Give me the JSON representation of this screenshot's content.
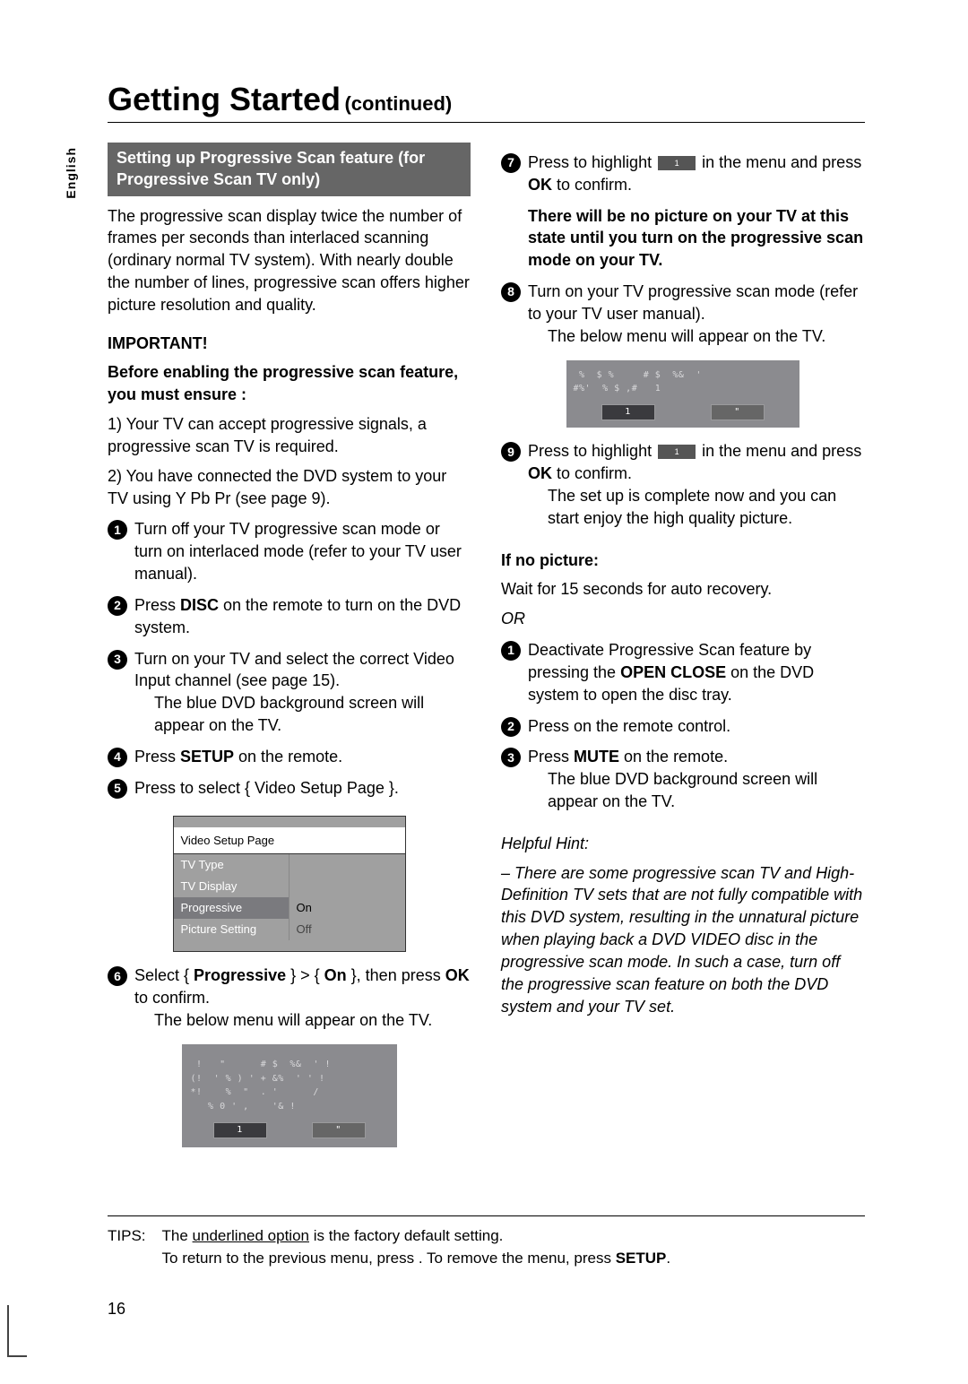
{
  "header": {
    "title": "Getting Started",
    "continued": "(continued)"
  },
  "lang_tab": "English",
  "left": {
    "band": "Setting up Progressive Scan feature (for Progressive Scan TV only)",
    "intro": "The progressive scan display twice the number of frames per seconds than interlaced scanning (ordinary normal TV system).  With nearly double the number of lines, progressive scan offers higher picture resolution and quality.",
    "important": "IMPORTANT!",
    "before": "Before enabling the progressive scan feature, you must ensure :",
    "ensure1": "1) Your TV can accept progressive signals, a progressive scan TV is required.",
    "ensure2": "2) You have connected the DVD system to your TV using Y Pb Pr (see page 9).",
    "s1": "Turn off your TV progressive scan mode or turn on interlaced mode (refer to your TV user manual).",
    "s2_a": "Press ",
    "s2_b": "DISC",
    "s2_c": " on the remote to turn on the DVD system.",
    "s3_a": "Turn on your TV and select the correct Video Input channel (see page 15).",
    "s3_res": "The blue DVD background screen will appear on the TV.",
    "s4_a": "Press ",
    "s4_b": "SETUP",
    "s4_c": " on the remote.",
    "s5": "Press      to select { Video Setup Page }.",
    "vsp": {
      "title": "Video Setup Page",
      "rows": [
        {
          "l": "TV Type",
          "r": ""
        },
        {
          "l": "TV Display",
          "r": ""
        },
        {
          "l": "Progressive",
          "r": "On",
          "sel": true
        },
        {
          "l": "Picture Setting",
          "r": "Off"
        }
      ]
    },
    "s6_a": "Select { ",
    "s6_b": "Progressive",
    "s6_c": " } > { ",
    "s6_d": "On",
    "s6_e": " }, then press ",
    "s6_f": "OK",
    "s6_g": " to confirm.",
    "s6_res": "The below menu will appear on the TV.",
    "dlg1": {
      "l1": " !   \"      # $  %&  ' !",
      "l2": "(!  ' % ) ' + &%  ' ' !",
      "l3": "*!    %  \"  . '      /",
      "l4": "   % 0 ' ,    '& !",
      "ok": "1",
      "cancel": "\""
    }
  },
  "right": {
    "s7_a": "Press      to highlight ",
    "s7_b": " in the menu and press ",
    "s7_c": "OK",
    "s7_d": " to confirm.",
    "warn1": "There will be no picture on your TV at this state until you turn on the progressive scan mode on your TV.",
    "s8_a": "Turn on your TV progressive scan mode (refer to your TV user manual).",
    "s8_res": "The below menu will appear on the TV.",
    "dlg2": {
      "l1": " %  $ %     # $  %&  '",
      "l2": "#%'  % $ ,#   1",
      "ok": "1",
      "cancel": "\""
    },
    "s9_a": "Press      to highlight ",
    "s9_b": " in the menu and press ",
    "s9_c": "OK",
    "s9_d": " to confirm.",
    "s9_res": "The set up is complete now and you can start enjoy the high quality picture.",
    "nopic_h": "If no picture:",
    "nopic_p": "Wait for 15 seconds for auto recovery.",
    "or": "OR",
    "r1_a": "Deactivate Progressive Scan feature by pressing the ",
    "r1_b": "OPEN CLOSE",
    "r1_c": "     on the DVD system to open the disc tray.",
    "r2": "Press      on the remote control.",
    "r3_a": "Press ",
    "r3_b": "MUTE",
    "r3_c": " on the remote.",
    "r3_res": "The blue DVD background screen will appear on the TV.",
    "hint_h": "Helpful Hint:",
    "hint_p": "– There are some progressive scan TV and High-Definition TV sets that are not fully compatible with this DVD system, resulting in the unnatural picture when playing back a DVD VIDEO disc in the progressive scan mode.  In such a case, turn off the progressive scan feature on both the DVD system and your TV set."
  },
  "tips": {
    "label": "TIPS:",
    "l1_a": "The ",
    "l1_b": "underlined option",
    "l1_c": " is the factory default setting.",
    "l2_a": "To return to the previous menu, press    .  To remove the menu, press ",
    "l2_b": "SETUP",
    "l2_c": "."
  },
  "page_number": "16"
}
